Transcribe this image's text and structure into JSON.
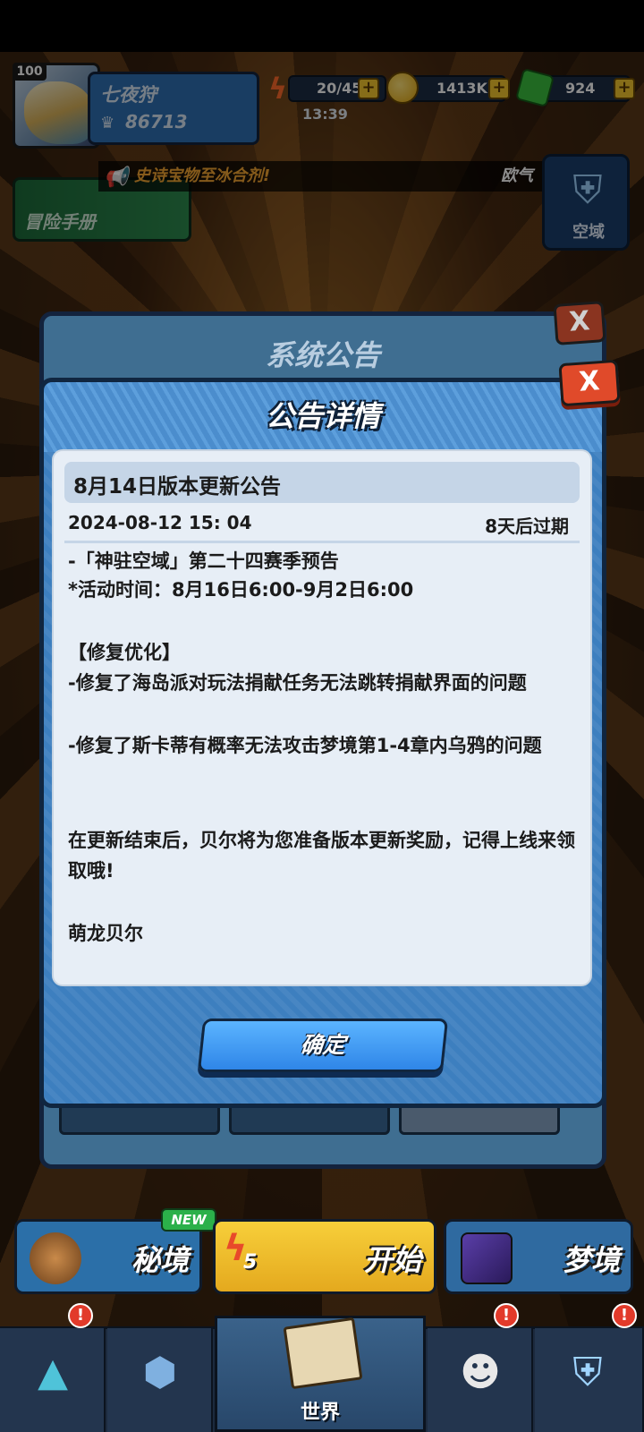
{
  "player": {
    "level": "100",
    "name": "七夜狩",
    "power": "86713"
  },
  "resources": {
    "energy": "20/45",
    "energy_timer": "13:39",
    "coins": "1413K",
    "gems": "924",
    "plus": "+"
  },
  "marquee": {
    "part1": "史诗宝物至冰合剂!",
    "part2": "欧气"
  },
  "side": {
    "manual": "冒险手册",
    "sky_domain": "空域"
  },
  "back_panel": {
    "title": "系统公告",
    "close": "X"
  },
  "dialog": {
    "title": "公告详情",
    "close": "X",
    "notice_title": "8月14日版本更新公告",
    "date": "2024-08-12 15: 04",
    "expiry": "8天后过期",
    "lines": [
      "-「神驻空域」第二十四赛季预告",
      "*活动时间：8月16日6:00-9月2日6:00",
      "",
      "【修复优化】",
      "-修复了海岛派对玩法捐献任务无法跳转捐献界面的问题",
      "-修复了斯卡蒂有概率无法攻击梦境第1-4章内乌鸦的问题",
      "",
      "在更新结束后，贝尔将为您准备版本更新奖励，记得上线来领取哦!",
      "",
      "萌龙贝尔"
    ],
    "ok": "确定"
  },
  "actions": {
    "secret": "秘境",
    "new_badge": "NEW",
    "start": "开始",
    "start_cost": "5",
    "dream": "梦境"
  },
  "nav": {
    "world": "世界",
    "badge": "!"
  },
  "colors": {
    "dialog_blue": "#3d7fbf",
    "ok_button": "#2f86e8",
    "close_red": "#e04a2a",
    "start_yellow": "#f7cf3a"
  }
}
